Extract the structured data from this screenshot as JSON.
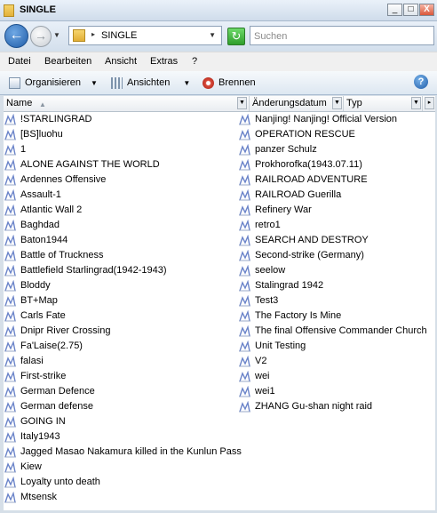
{
  "window": {
    "title": "SINGLE",
    "min_glyph": "_",
    "max_glyph": "□",
    "close_glyph": "X"
  },
  "nav": {
    "back_glyph": "←",
    "fwd_glyph": "→",
    "dropdown_glyph": "▼",
    "crumb_arrow": "▸",
    "current_folder": "SINGLE",
    "refresh_glyph": "↻"
  },
  "search": {
    "placeholder": "Suchen"
  },
  "menu": {
    "items": [
      "Datei",
      "Bearbeiten",
      "Ansicht",
      "Extras",
      "?"
    ]
  },
  "toolbar": {
    "organize": "Organisieren",
    "views": "Ansichten",
    "burn": "Brennen",
    "dropdown_glyph": "▼",
    "help_glyph": "?"
  },
  "columns": {
    "name": "Name",
    "modified": "Änderungsdatum",
    "type": "Typ",
    "sort_glyph": "▲",
    "drop_glyph": "▼",
    "scroll_glyph": "▸"
  },
  "icons": {
    "file": "scenario-file-icon",
    "folder": "folder-icon"
  },
  "colors": {
    "accent": "#1f5ca8",
    "background": "#d6dfe8"
  },
  "files_left": [
    "!STARLINGRAD",
    "[BS]luohu",
    "1",
    "ALONE AGAINST THE WORLD",
    "Ardennes Offensive",
    "Assault-1",
    "Atlantic Wall 2",
    "Baghdad",
    "Baton1944",
    "Battle of Truckness",
    "Battlefield Starlingrad(1942-1943)",
    "Bloddy",
    "BT+Map",
    "Carls Fate",
    "Dnipr River Crossing",
    "Fa'Laise(2.75)",
    "falasi",
    "First-strike",
    "German Defence",
    "German defense",
    "GOING IN",
    "Italy1943",
    "Jagged Masao Nakamura killed in the Kunlun Pass",
    "Kiew",
    "Loyalty unto death",
    "Mtsensk"
  ],
  "files_right": [
    "Nanjing! Nanjing! Official Version",
    "OPERATION RESCUE",
    "panzer Schulz",
    "Prokhorofka(1943.07.11)",
    "RAILROAD ADVENTURE",
    "RAILROAD Guerilla",
    "Refinery War",
    "retro1",
    "SEARCH AND DESTROY",
    "Second-strike (Germany)",
    "seelow",
    "Stalingrad 1942",
    "Test3",
    "The Factory Is Mine",
    "The final Offensive Commander Church",
    "Unit Testing",
    "V2",
    "wei",
    "wei1",
    "ZHANG Gu-shan night raid"
  ]
}
